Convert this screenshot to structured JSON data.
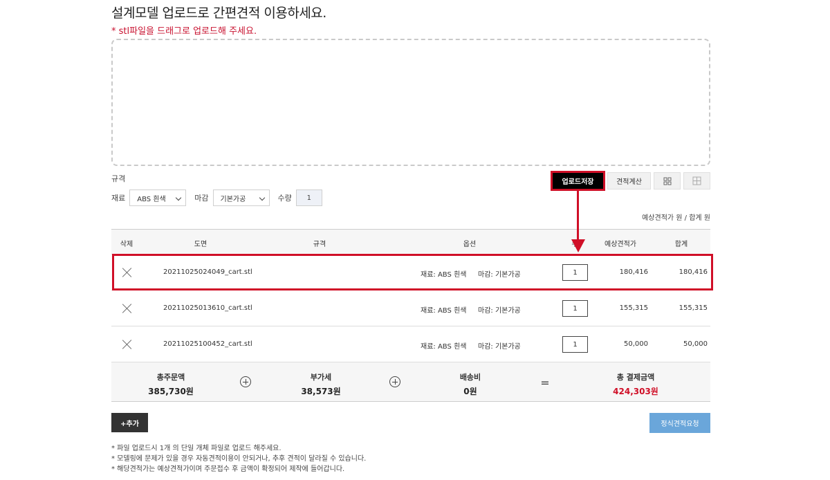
{
  "header": {
    "title": "설계모델 업로드로 간편견적 이용하세요.",
    "subtitle": "* stl파일을 드래그로 업로드해 주세요."
  },
  "spec": {
    "label": "규격",
    "material_label": "재료",
    "material_value": "ABS 흰색",
    "finish_label": "마감",
    "finish_value": "기본가공",
    "quantity_label": "수량",
    "quantity_value": "1"
  },
  "toolbar": {
    "save_label": "업로드저장",
    "calc_label": "견적계산"
  },
  "estimate_summary": "예상견적가   원 / 합계   원",
  "table": {
    "headers": [
      "삭제",
      "도면",
      "규격",
      "옵션",
      "수",
      "예상견적가",
      "합계"
    ],
    "rows": [
      {
        "file": "20211025024049_cart.stl",
        "material": "재료: ABS 흰색",
        "finish": "마감: 기본가공",
        "qty": "1",
        "estimate": "180,416",
        "total": "180,416"
      },
      {
        "file": "20211025013610_cart.stl",
        "material": "재료: ABS 흰색",
        "finish": "마감: 기본가공",
        "qty": "1",
        "estimate": "155,315",
        "total": "155,315"
      },
      {
        "file": "20211025100452_cart.stl",
        "material": "재료: ABS 흰색",
        "finish": "마감: 기본가공",
        "qty": "1",
        "estimate": "50,000",
        "total": "50,000"
      }
    ]
  },
  "totals": {
    "order_label": "총주문액",
    "order_value": "385,730원",
    "vat_label": "부가세",
    "vat_value": "38,573원",
    "shipping_label": "배송비",
    "shipping_value": "0원",
    "equals": "=",
    "grand_label": "총 결제금액",
    "grand_value": "424,303원"
  },
  "actions": {
    "add_label": "+추가",
    "request_label": "정식견적요청"
  },
  "notes": [
    "* 파일 업로드시 1개 의 단일 개체 파일로 업로드 해주세요.",
    "* 모델링에 문제가 있을 경우 자동견적이용이 안되거나, 추후 견적이 달라질 수 있습니다.",
    "* 해당견적가는 예상견적가이며 주문접수 후 금액이 확정되어 제작에 들어갑니다."
  ],
  "colors": {
    "accent_red": "#d00f27",
    "request_blue": "#6aa6da"
  }
}
